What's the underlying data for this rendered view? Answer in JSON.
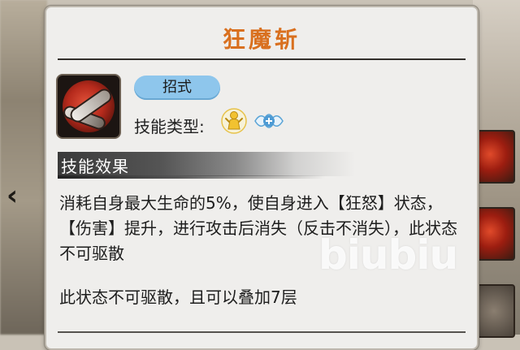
{
  "skill": {
    "name": "狂魔斩",
    "type_badge": "招式",
    "type_label": "技能类型:",
    "type_icons": [
      "attack-type-icon",
      "assist-type-icon"
    ]
  },
  "section": {
    "effect_header": "技能效果"
  },
  "description": {
    "para1": "消耗自身最大生命的5%，使自身进入【狂怒】状态，【伤害】提升，进行攻击后消失（反击不消失），此状态不可驱散",
    "para2": "此状态不可驱散，且可以叠加7层"
  },
  "watermark": "biubiu",
  "colors": {
    "title": "#d9701f",
    "badge": "#8ec6ec",
    "panel": "#efeeec"
  }
}
